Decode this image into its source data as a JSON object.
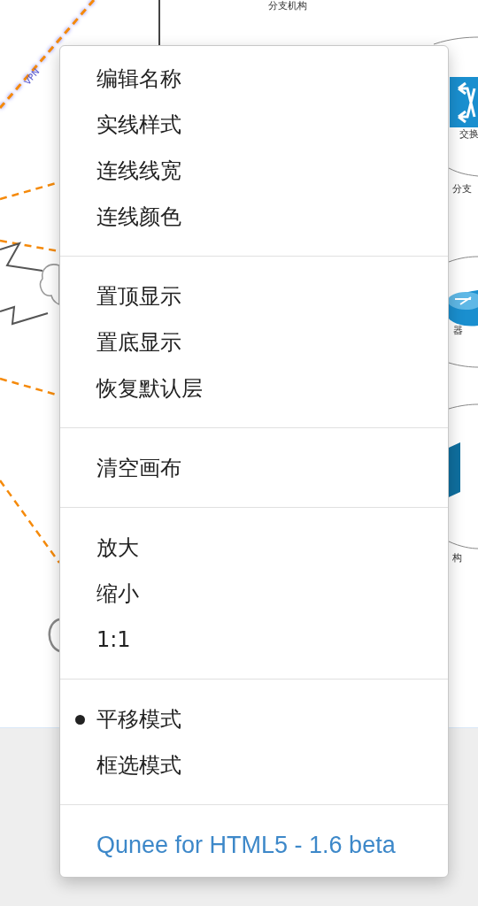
{
  "canvas": {
    "labels": [
      {
        "text": "分支机构",
        "kind": "node"
      },
      {
        "text": "VPN",
        "kind": "link"
      },
      {
        "text": "交换",
        "kind": "node"
      },
      {
        "text": "分支",
        "kind": "node"
      },
      {
        "text": "器",
        "kind": "node"
      },
      {
        "text": "构",
        "kind": "node"
      }
    ]
  },
  "context_menu": {
    "sections": [
      {
        "items": [
          {
            "kind": "item",
            "label": "编辑名称"
          },
          {
            "kind": "item",
            "label": "实线样式"
          },
          {
            "kind": "item",
            "label": "连线线宽"
          },
          {
            "kind": "item",
            "label": "连线颜色"
          }
        ]
      },
      {
        "items": [
          {
            "kind": "item",
            "label": "置顶显示"
          },
          {
            "kind": "item",
            "label": "置底显示"
          },
          {
            "kind": "item",
            "label": "恢复默认层"
          }
        ]
      },
      {
        "items": [
          {
            "kind": "item",
            "label": "清空画布"
          }
        ]
      },
      {
        "items": [
          {
            "kind": "item",
            "label": "放大"
          },
          {
            "kind": "item",
            "label": "缩小"
          },
          {
            "kind": "item",
            "label": "1:1"
          }
        ]
      },
      {
        "items": [
          {
            "kind": "radio",
            "label": "平移模式",
            "selected": true
          },
          {
            "kind": "radio",
            "label": "框选模式",
            "selected": false
          }
        ]
      },
      {
        "items": [
          {
            "kind": "link",
            "label": "Qunee for HTML5 - 1.6 beta"
          }
        ]
      }
    ]
  }
}
